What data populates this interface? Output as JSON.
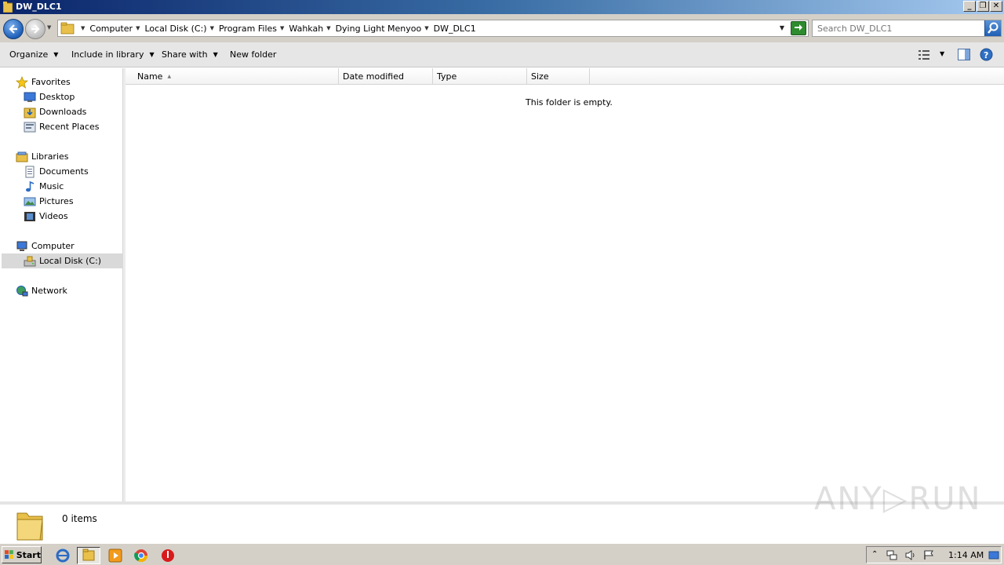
{
  "window": {
    "title": "DW_DLC1",
    "controls": {
      "minimize": "_",
      "restore": "❐",
      "close": "✕"
    }
  },
  "address": {
    "breadcrumbs": [
      "Computer",
      "Local Disk (C:)",
      "Program Files",
      "Wahkah",
      "Dying Light Menyoo",
      "DW_DLC1"
    ],
    "search_placeholder": "Search DW_DLC1"
  },
  "toolbar": {
    "organize": "Organize",
    "include_in_library": "Include in library",
    "share_with": "Share with",
    "new_folder": "New folder"
  },
  "nav": {
    "favorites": {
      "label": "Favorites",
      "items": [
        "Desktop",
        "Downloads",
        "Recent Places"
      ]
    },
    "libraries": {
      "label": "Libraries",
      "items": [
        "Documents",
        "Music",
        "Pictures",
        "Videos"
      ]
    },
    "computer": {
      "label": "Computer",
      "items": [
        "Local Disk (C:)"
      ]
    },
    "network": {
      "label": "Network"
    }
  },
  "columns": [
    "Name",
    "Date modified",
    "Type",
    "Size"
  ],
  "empty_message": "This folder is empty.",
  "details": {
    "item_count": "0 items"
  },
  "watermark": "ANY▷RUN",
  "taskbar": {
    "start": "Start",
    "clock": "1:14 AM"
  },
  "colors": {
    "selected_nav": "#d9d9d9",
    "taskbar": "#d4d0c8",
    "title_gradient_start": "#0a246a"
  }
}
